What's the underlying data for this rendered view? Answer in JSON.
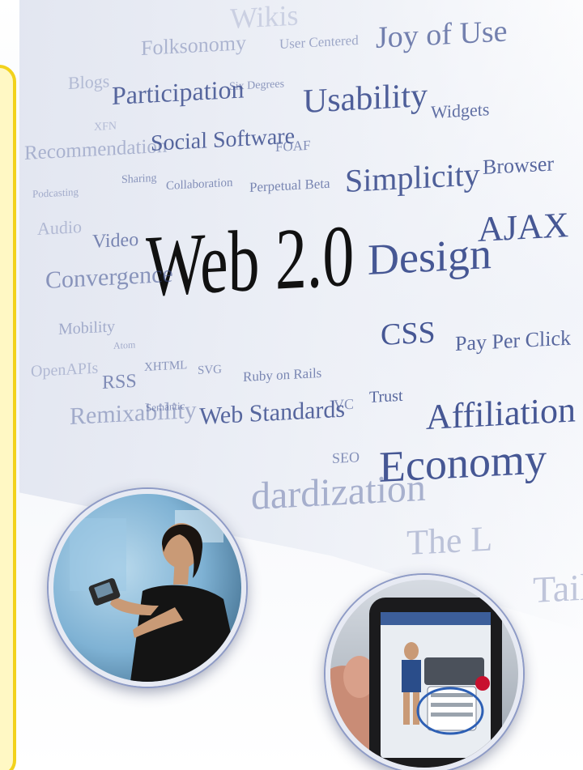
{
  "words": [
    {
      "id": "word-wikis",
      "text": "Wikis"
    },
    {
      "id": "word-folksonomy",
      "text": "Folksonomy"
    },
    {
      "id": "word-user-centered",
      "text": "User Centered"
    },
    {
      "id": "word-joy-of-use",
      "text": "Joy of Use"
    },
    {
      "id": "word-blogs",
      "text": "Blogs"
    },
    {
      "id": "word-participation",
      "text": "Participation"
    },
    {
      "id": "word-six-degrees",
      "text": "Six Degrees"
    },
    {
      "id": "word-usability",
      "text": "Usability"
    },
    {
      "id": "word-widgets",
      "text": "Widgets"
    },
    {
      "id": "word-xfn",
      "text": "XFN"
    },
    {
      "id": "word-recommendation",
      "text": "Recommendation"
    },
    {
      "id": "word-social-software",
      "text": "Social Software"
    },
    {
      "id": "word-foaf",
      "text": "FOAF"
    },
    {
      "id": "word-browser",
      "text": "Browser"
    },
    {
      "id": "word-sharing",
      "text": "Sharing"
    },
    {
      "id": "word-collaboration",
      "text": "Collaboration"
    },
    {
      "id": "word-perpetual-beta",
      "text": "Perpetual Beta"
    },
    {
      "id": "word-simplicity",
      "text": "Simplicity"
    },
    {
      "id": "word-podcasting",
      "text": "Podcasting"
    },
    {
      "id": "word-ajax",
      "text": "AJAX"
    },
    {
      "id": "word-audio",
      "text": "Audio"
    },
    {
      "id": "word-video",
      "text": "Video"
    },
    {
      "id": "word-web-2-0",
      "text": "Web 2.0"
    },
    {
      "id": "word-design",
      "text": "Design"
    },
    {
      "id": "word-convergence",
      "text": "Convergence"
    },
    {
      "id": "word-css",
      "text": "CSS"
    },
    {
      "id": "word-pay-per-click",
      "text": "Pay Per Click"
    },
    {
      "id": "word-mobility",
      "text": "Mobility"
    },
    {
      "id": "word-atom",
      "text": "Atom"
    },
    {
      "id": "word-xhtml",
      "text": "XHTML"
    },
    {
      "id": "word-svg",
      "text": "SVG"
    },
    {
      "id": "word-ruby-on-rails",
      "text": "Ruby on Rails"
    },
    {
      "id": "word-openapis",
      "text": "OpenAPIs"
    },
    {
      "id": "word-rss",
      "text": "RSS"
    },
    {
      "id": "word-trust",
      "text": "Trust"
    },
    {
      "id": "word-vc",
      "text": "VC"
    },
    {
      "id": "word-affiliation",
      "text": "Affiliation"
    },
    {
      "id": "word-semantic",
      "text": "Semantic"
    },
    {
      "id": "word-web-standards",
      "text": "Web Standards"
    },
    {
      "id": "word-remixability",
      "text": "Remixability"
    },
    {
      "id": "word-seo",
      "text": "SEO"
    },
    {
      "id": "word-economy",
      "text": "Economy"
    },
    {
      "id": "word-standardization",
      "text": "dardization"
    },
    {
      "id": "word-the-long",
      "text": "The L"
    },
    {
      "id": "word-tail",
      "text": "Tail"
    }
  ],
  "colors": {
    "word_blue": "#3d4f8f",
    "word_dark": "#111111",
    "frame_yellow": "#f2d21c",
    "circle_border": "#8e9bc6"
  }
}
